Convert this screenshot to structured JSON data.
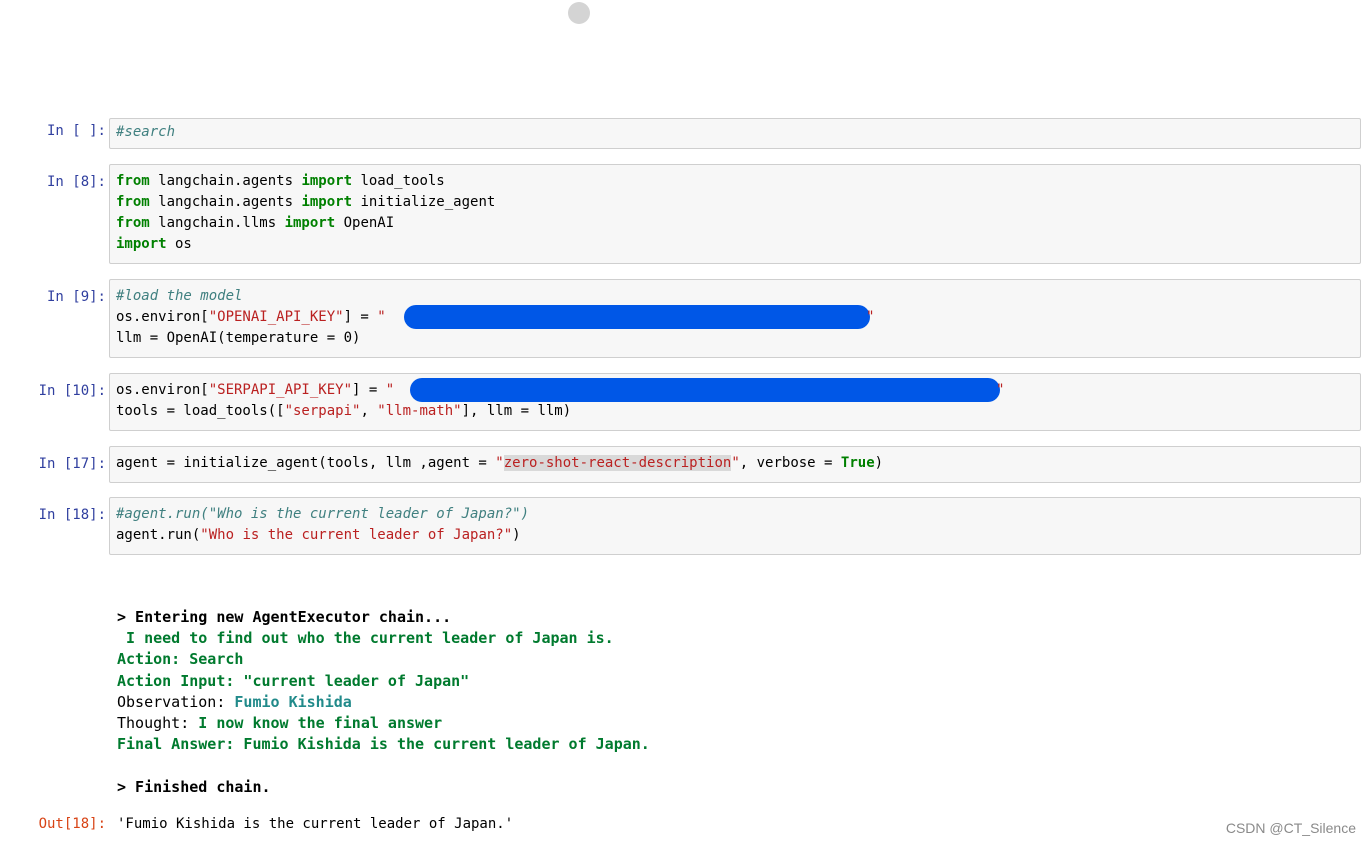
{
  "cells": [
    {
      "prompt": "In [ ]:",
      "lines": [
        "#search"
      ]
    },
    {
      "prompt": "In [8]:",
      "lines": [
        [
          "from",
          " langchain.agents ",
          "import",
          " load_tools"
        ],
        [
          "from",
          " langchain.agents ",
          "import",
          " initialize_agent"
        ],
        [
          "from",
          " langchain.llms ",
          "import",
          " OpenAI"
        ],
        [
          "import",
          " os"
        ]
      ]
    },
    {
      "prompt": "In [9]:",
      "comment": "#load the model",
      "line2_prefix": "os.environ[",
      "key1": "\"OPENAI_API_KEY\"",
      "line2_mid": "] = ",
      "line3": "llm = OpenAI(temperature = 0)"
    },
    {
      "prompt": "In [10]:",
      "line1_prefix": "os.environ[",
      "key2": "\"SERPAPI_API_KEY\"",
      "line1_mid": "] = ",
      "line2_a": "tools = load_tools([",
      "serpapi": "\"serpapi\"",
      "comma": ", ",
      "llmmath": "\"llm-math\"",
      "line2_b": "], llm = llm)"
    },
    {
      "prompt": "In [17]:",
      "a": "agent = initialize_agent(tools, llm ,agent = ",
      "q1": "\"",
      "desc": "zero-shot-react-description",
      "q2": "\"",
      "b": ", verbose = ",
      "true": "True",
      "c": ")"
    },
    {
      "prompt": "In [18]:",
      "comment": "#agent.run(\"Who is the current leader of Japan?\")",
      "run_a": "agent.run(",
      "run_str": "\"Who is the current leader of Japan?\"",
      "run_b": ")"
    }
  ],
  "output": {
    "entering": "> Entering new AgentExecutor chain...",
    "thought1": " I need to find out who the current leader of Japan is.",
    "action": "Action: Search",
    "action_input": "Action Input: \"current leader of Japan\"",
    "obs_label": "Observation: ",
    "obs_value": "Fumio Kishida",
    "thought_label": "Thought: ",
    "thought_value": "I now know the final answer",
    "final": "Final Answer: Fumio Kishida is the current leader of Japan.",
    "finished": "> Finished chain.",
    "out_prompt": "Out[18]:",
    "result": "'Fumio Kishida is the current leader of Japan.'"
  },
  "watermark": "CSDN @CT_Silence",
  "colors": {
    "prompt_in": "#303f9f",
    "prompt_out": "#d84315",
    "keyword": "#008000",
    "string": "#ba2121",
    "redaction": "#0057e7"
  }
}
